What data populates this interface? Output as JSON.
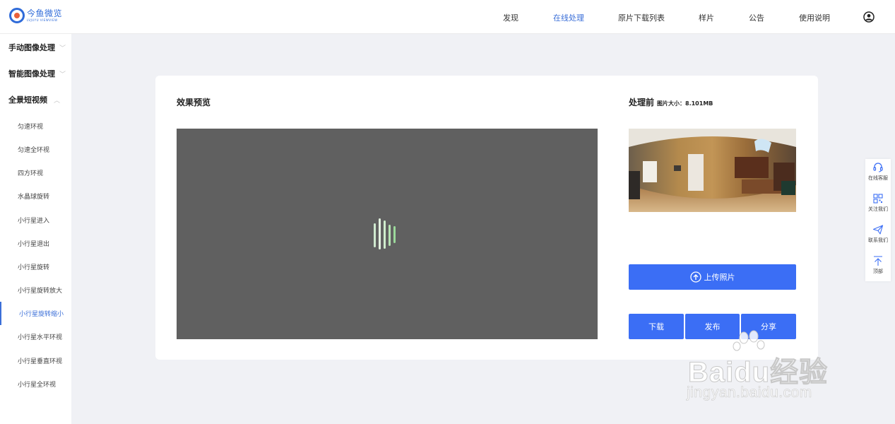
{
  "logo": {
    "name": "今鱼微览",
    "sub": "LVJUYU VIEWVIEW"
  },
  "nav": {
    "items": [
      {
        "label": "发现",
        "active": false
      },
      {
        "label": "在线处理",
        "active": true
      },
      {
        "label": "原片下载列表",
        "active": false
      },
      {
        "label": "样片",
        "active": false
      },
      {
        "label": "公告",
        "active": false
      },
      {
        "label": "使用说明",
        "active": false
      }
    ],
    "user_icon": "user-circle-icon"
  },
  "sidebar": {
    "groups": [
      {
        "label": "手动图像处理",
        "chevron": "chevron-down-icon"
      },
      {
        "label": "智能图像处理",
        "chevron": "chevron-down-icon"
      },
      {
        "label": "全景短视频",
        "chevron": "chevron-up-icon"
      }
    ],
    "items": [
      {
        "label": "匀速环视"
      },
      {
        "label": "匀速全环视"
      },
      {
        "label": "四方环视"
      },
      {
        "label": "水晶球旋转"
      },
      {
        "label": "小行星进入"
      },
      {
        "label": "小行星退出"
      },
      {
        "label": "小行星旋转"
      },
      {
        "label": "小行星旋转放大"
      },
      {
        "label": "小行星旋转缩小",
        "active": true
      },
      {
        "label": "小行星水平环视"
      },
      {
        "label": "小行星垂直环视"
      },
      {
        "label": "小行星全环视"
      }
    ]
  },
  "preview": {
    "title": "效果预览"
  },
  "before": {
    "title": "处理前",
    "size_label": "图片大小：8.101MB"
  },
  "buttons": {
    "upload": "上传照片",
    "download": "下载",
    "publish": "发布",
    "share": "分享"
  },
  "float_bar": {
    "items": [
      {
        "label": "在线客服",
        "icon": "headset-icon"
      },
      {
        "label": "关注我们",
        "icon": "qrcode-icon"
      },
      {
        "label": "联系我们",
        "icon": "paper-plane-icon"
      },
      {
        "label": "顶部",
        "icon": "arrow-top-icon"
      }
    ]
  },
  "watermark": {
    "main": "Baidu经验",
    "sub": "jingyan.baidu.com"
  },
  "colors": {
    "accent": "#3b6ef5",
    "nav_active": "#3b6fd8",
    "preview_bg": "#606060",
    "page_bg": "#f0f1f5"
  }
}
